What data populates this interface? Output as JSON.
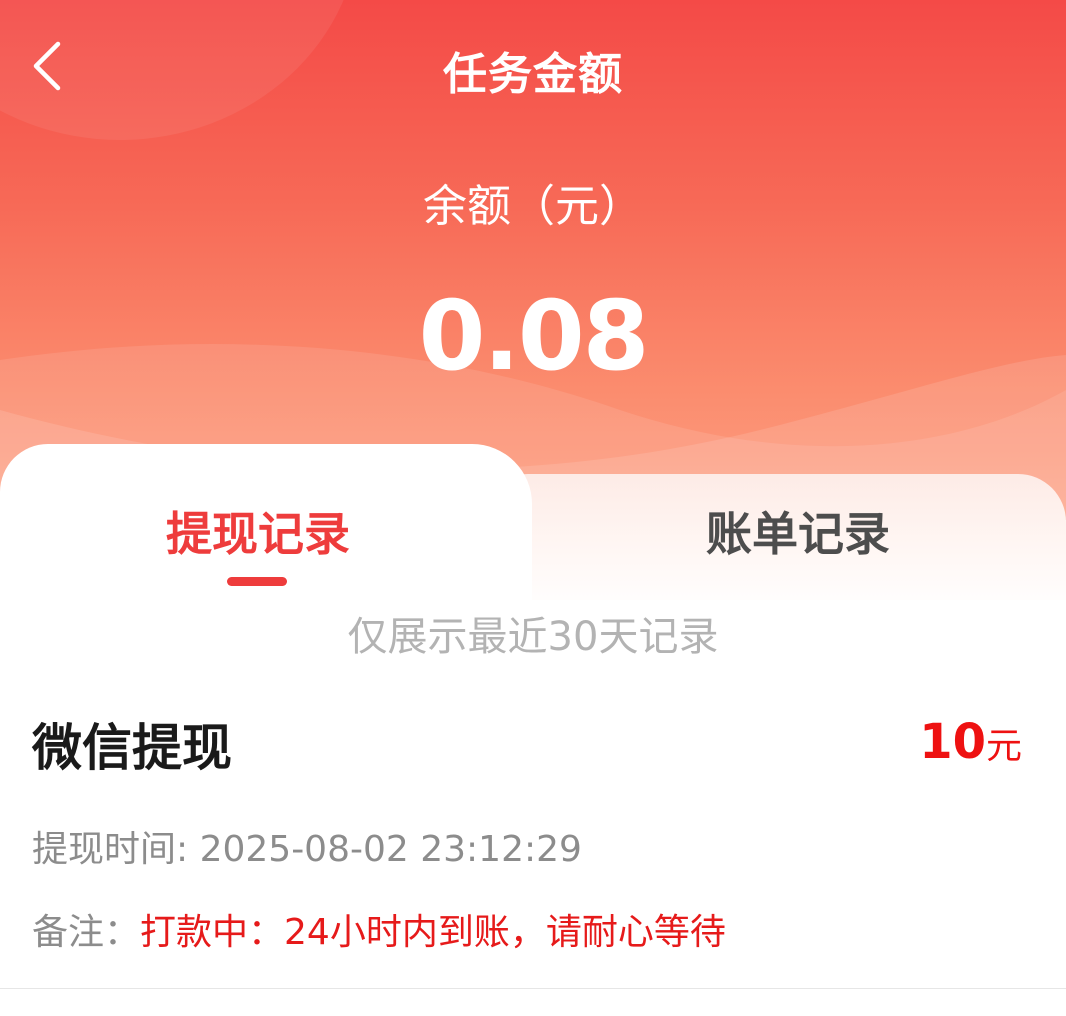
{
  "header": {
    "title": "任务金额",
    "balance_label": "余额（元）",
    "balance_value": "0.08"
  },
  "tabs": [
    {
      "label": "提现记录",
      "active": true
    },
    {
      "label": "账单记录",
      "active": false
    }
  ],
  "notice": "仅展示最近30天记录",
  "records": [
    {
      "title": "微信提现",
      "amount": "10",
      "amount_unit": "元",
      "time_label": "提现时间: ",
      "time": "2025-08-02 23:12:29",
      "note_label": "备注：",
      "note": "打款中：24小时内到账，请耐心等待"
    }
  ],
  "colors": {
    "accent": "#ee3c3c",
    "header_top": "#f44a47",
    "header_bottom": "#fda083",
    "amount": "#ee1111",
    "muted": "#8c8c8c"
  },
  "icons": {
    "back": "chevron-left-icon"
  }
}
